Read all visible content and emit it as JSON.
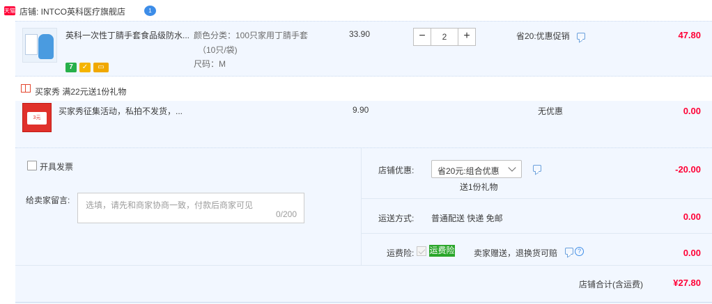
{
  "shop": {
    "badge_text": "天猫",
    "label": "店铺: INTCO英科医疗旗舰店",
    "ww_icon_text": "1"
  },
  "item1": {
    "title": "英科一次性丁腈手套食品级防水...",
    "sku_color": "颜色分类：100只家用丁腈手套",
    "sku_color_line2": "（10只/袋)",
    "sku_size": "尺码：M",
    "price": "33.90",
    "qty": "2",
    "promo": "省20:优惠促销",
    "amount": "47.80",
    "badges": [
      {
        "text": "7",
        "color": "#27b04a"
      },
      {
        "text": "✓",
        "color": "#f5b400"
      },
      {
        "text": "▭",
        "color": "#f0a800"
      }
    ]
  },
  "gift": {
    "title": "买家秀   满22元送1份礼物",
    "item_title": "买家秀征集活动，私拍不发货，...",
    "card_text": "3元",
    "price": "9.90",
    "promo": "无优惠",
    "amount": "0.00"
  },
  "invoice": {
    "label": "开具发票"
  },
  "message": {
    "label": "给卖家留言:",
    "placeholder": "选填，请先和商家协商一致，付款后商家可见",
    "count": "0/200"
  },
  "shop_discount": {
    "label": "店铺优惠:",
    "selected": "省20元:组合优惠",
    "gift_note": "送1份礼物",
    "amount": "-20.00"
  },
  "shipping": {
    "label": "运送方式:",
    "value": "普通配送 快递 免邮",
    "amount": "0.00"
  },
  "insurance": {
    "label": "运费险:",
    "badge": "运费险",
    "value": "卖家赠送，退换货可赔",
    "amount": "0.00"
  },
  "total": {
    "label": "店铺合计(含运费)",
    "amount": "¥27.80"
  }
}
